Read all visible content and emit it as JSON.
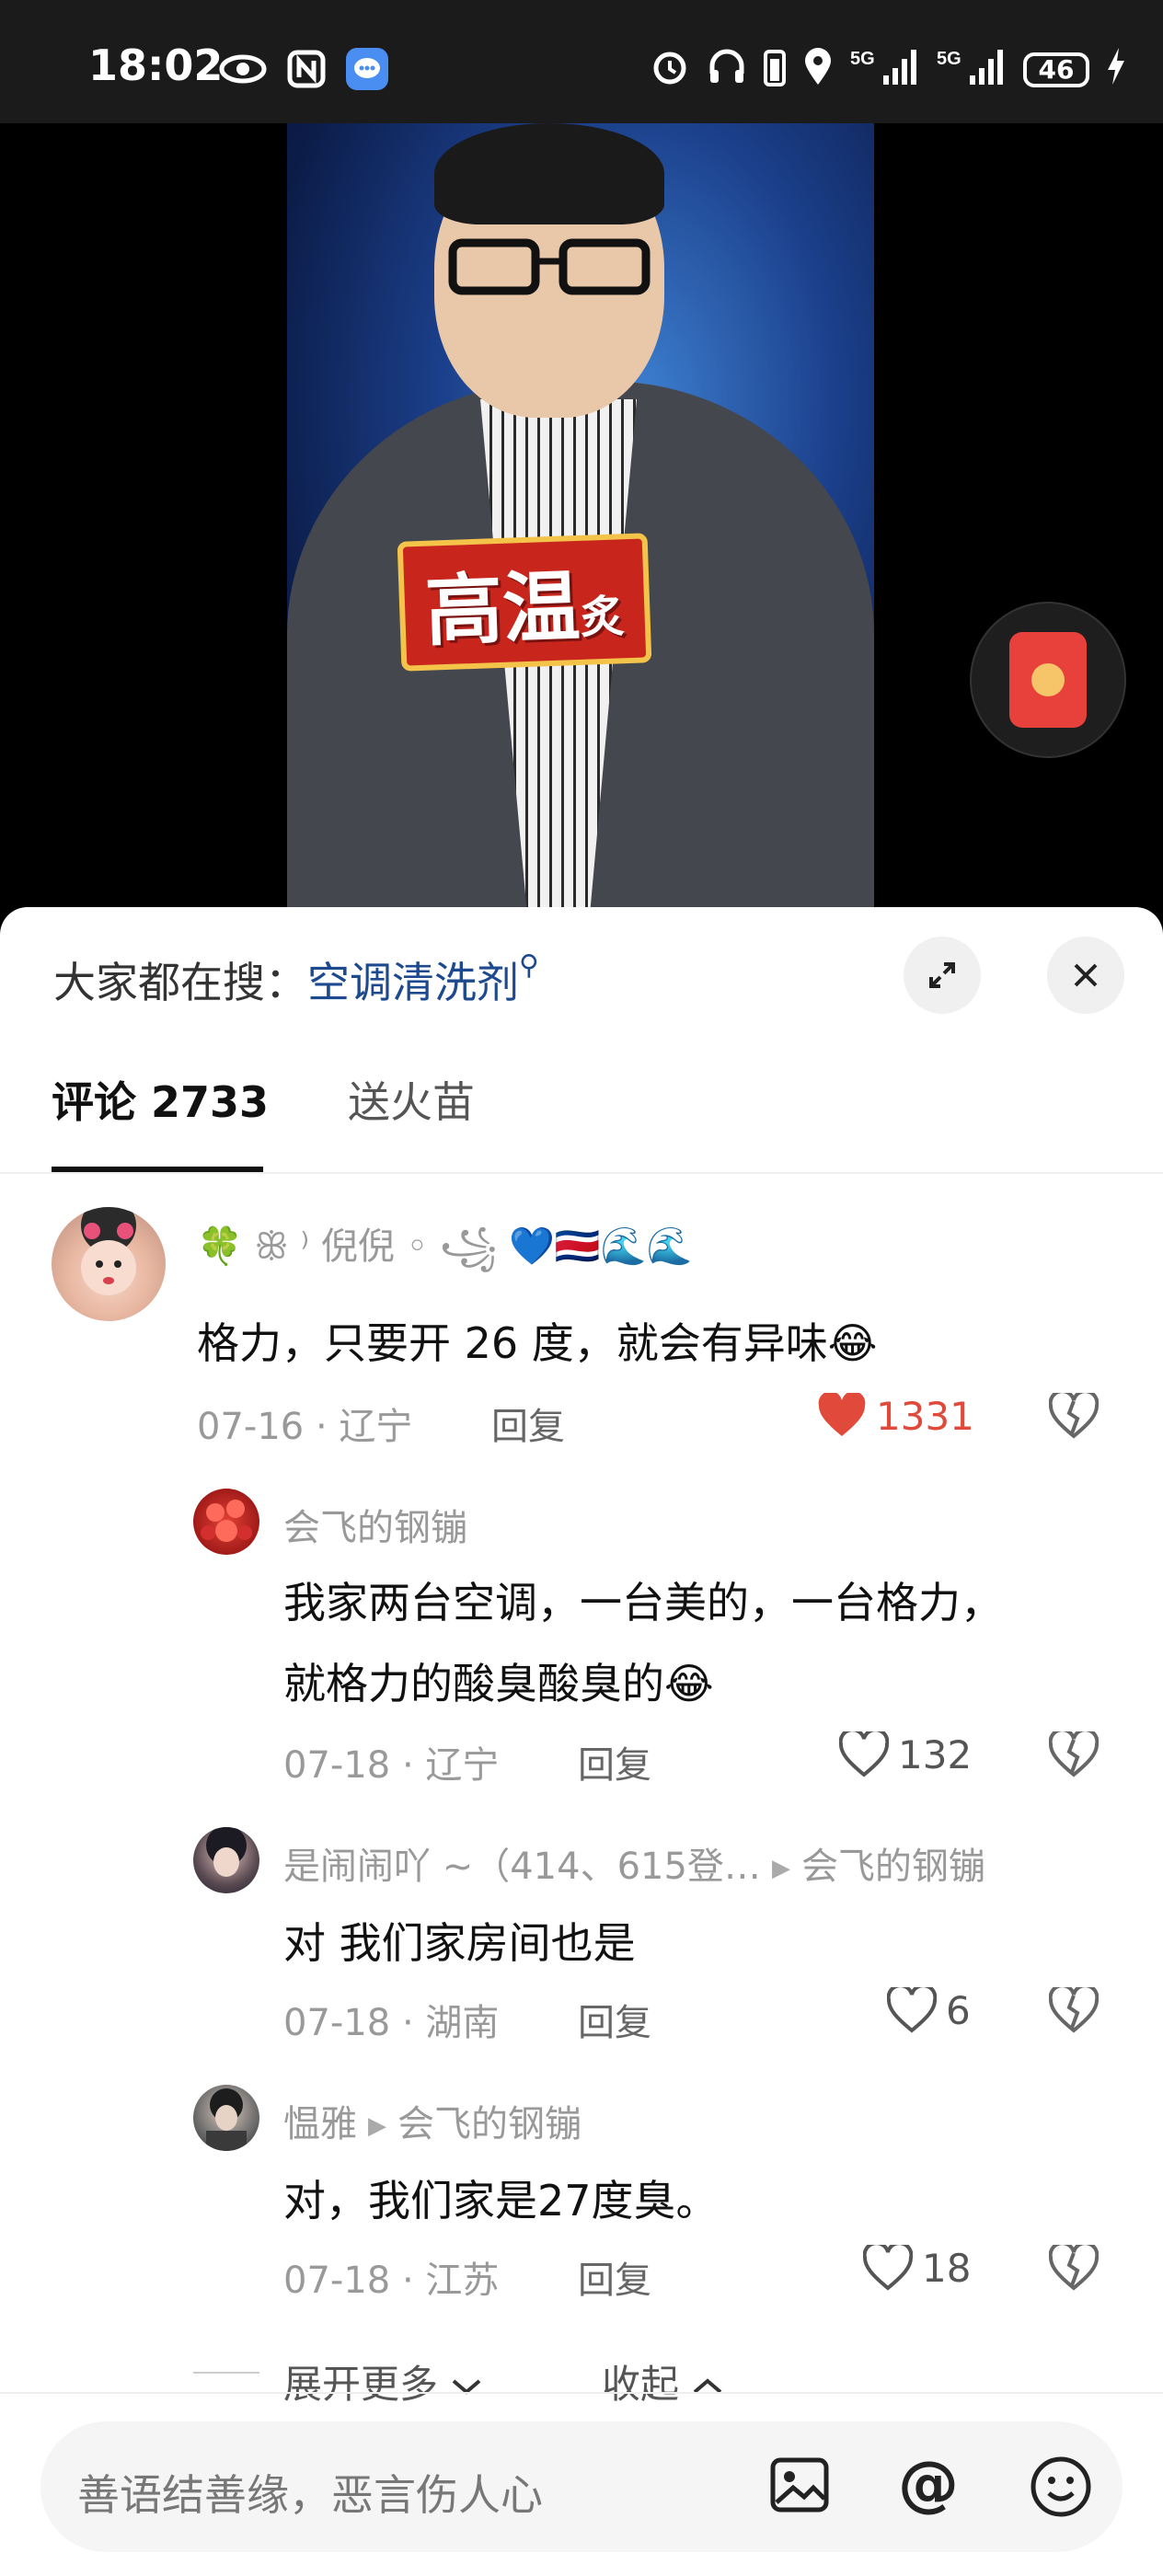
{
  "status_bar": {
    "time": "18:02",
    "battery": "46",
    "network1": "5G",
    "network2": "5G"
  },
  "video": {
    "caption_main": "高温",
    "caption_small": "炙"
  },
  "sheet": {
    "search_prefix": "大家都在搜：",
    "search_term": "空调清洗剂",
    "tabs": [
      {
        "label": "评论 2733",
        "active": true
      },
      {
        "label": "送火苗",
        "active": false
      }
    ]
  },
  "comments": [
    {
      "username": "🍀 ꕥ ⁾ 倪倪 ◦ ꧁ 💙🇨🇷🌊🌊",
      "text": "格力，只要开 26 度，就会有异味😂",
      "date": "07-16 · 辽宁",
      "reply": "回复",
      "likes": "1331",
      "liked": true
    },
    {
      "username": "会飞的钢镚",
      "text_line1": "我家两台空调，一台美的，一台格力，",
      "text_line2": "就格力的酸臭酸臭的😂",
      "date": "07-18 · 辽宁",
      "reply": "回复",
      "likes": "132"
    },
    {
      "username": "是闹闹吖 ~（414、615登…",
      "reply_to": "会飞的钢镚",
      "text": "对 我们家房间也是",
      "date": "07-18 · 湖南",
      "reply": "回复",
      "likes": "6"
    },
    {
      "username": "愠雅",
      "reply_to": "会飞的钢镚",
      "text": "对，我们家是27度臭。",
      "date": "07-18 · 江苏",
      "reply": "回复",
      "likes": "18"
    }
  ],
  "expand_more": "展开更多",
  "collapse": "收起",
  "input": {
    "placeholder": "善语结善缘，恶言伤人心"
  },
  "colors": {
    "accent_link": "#1d4a8f",
    "like_red": "#e14a3b"
  }
}
